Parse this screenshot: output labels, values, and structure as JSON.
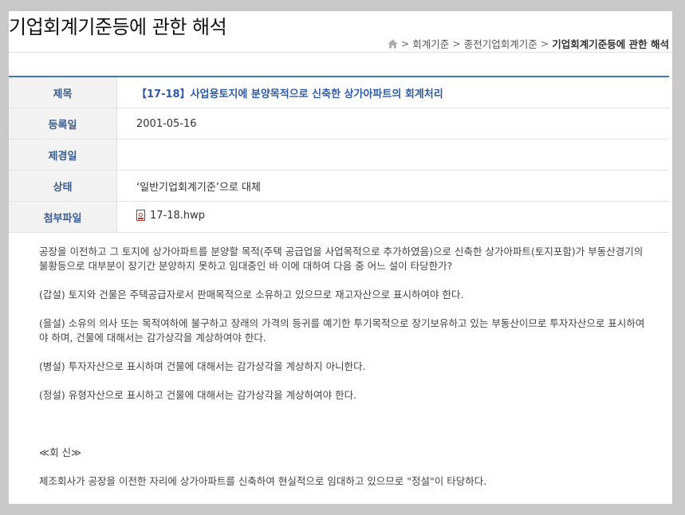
{
  "page": {
    "title": "기업회계기준등에 관한 해석"
  },
  "breadcrumb": {
    "sep": ">",
    "items": [
      "회계기준",
      "종전기업회계기준",
      "기업회계기준등에 관한 해석"
    ]
  },
  "info": {
    "rows": [
      {
        "label": "제목",
        "value": "【17-18】사업용토지에 분양목적으로 신축한 상가아파트의 회계처리"
      },
      {
        "label": "등록일",
        "value": "2001-05-16"
      },
      {
        "label": "제경일",
        "value": ""
      },
      {
        "label": "상태",
        "value": "‘일반기업회계기준’으로 대체"
      },
      {
        "label": "첨부파일",
        "value": "17-18.hwp"
      }
    ]
  },
  "content": {
    "question": "공장을 이전하고 그 토지에 상가아파트를 분양할 목적(주택 공급업을 사업목적으로 추가하였음)으로 신축한 상가아파트(토지포함)가 부동산경기의 불황등으로 대부분이 장기간 분양하지 못하고 임대중인 바 이에 대하여 다음 중 어느 설이 타당한가?",
    "opinion_a": "(갑설) 토지와 건물은 주택공급자로서 판매목적으로 소유하고 있으므로 재고자산으로 표시하여야 한다.",
    "opinion_b": "(을설) 소유의 의사 또는 목적여하에 불구하고 장래의 가격의 등귀를 예기한 투기목적으로 장기보유하고 있는 부동산이므로 투자자산으로 표시하여야 하며, 건물에 대해서는 감가상각을 계상하여야 한다.",
    "opinion_c": "(병설) 투자자산으로 표시하며 건물에 대해서는 감가상각을 계상하지 아니한다.",
    "opinion_d": "(정설) 유형자산으로 표시하고 건물에 대해서는 감가상각을 계상하여야 한다.",
    "reply_heading": "≪회 신≫",
    "reply": "제조회사가 공장을 이전한 자리에 상가아파트를 신축하여 현실적으로 임대하고 있으므로 \"정설\"이 타당하다."
  }
}
